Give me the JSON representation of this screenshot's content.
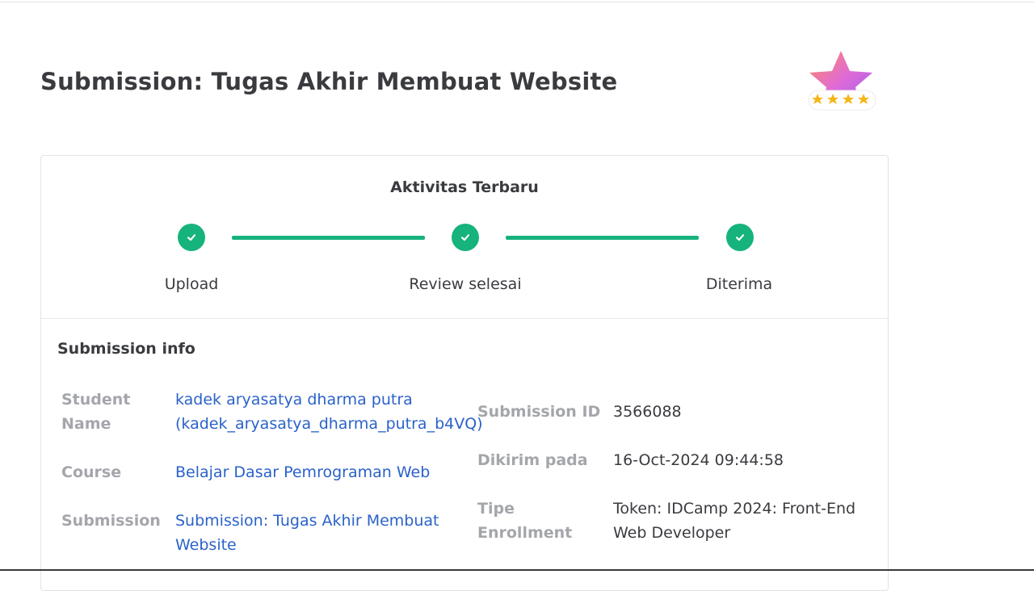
{
  "page": {
    "title": "Submission: Tugas Akhir Membuat Website",
    "badge_icon": "star-rating-badge-icon",
    "badge_stars": 4
  },
  "activity": {
    "title": "Aktivitas Terbaru",
    "steps": [
      {
        "label": "Upload",
        "icon": "check-icon"
      },
      {
        "label": "Review selesai",
        "icon": "check-icon"
      },
      {
        "label": "Diterima",
        "icon": "check-icon"
      }
    ],
    "accent_color": "#16b37c"
  },
  "submission_info": {
    "title": "Submission info",
    "student_name_label_line1": "Student",
    "student_name_label_line2": "Name",
    "student_name_line1": "kadek aryasatya dharma putra",
    "student_name_line2": "(kadek_aryasatya_dharma_putra_b4VQ)",
    "course_label": "Course",
    "course_value": "Belajar Dasar Pemrograman Web",
    "submission_label": "Submission",
    "submission_value_line1": "Submission: Tugas Akhir Membuat",
    "submission_value_line2": "Website",
    "submission_id_label": "Submission ID",
    "submission_id_value": "3566088",
    "sent_at_label": "Dikirim pada",
    "sent_at_value": "16-Oct-2024 09:44:58",
    "enrollment_label_line1": "Tipe",
    "enrollment_label_line2": "Enrollment",
    "enrollment_value_line1": "Token: IDCamp 2024: Front-End",
    "enrollment_value_line2": "Web Developer",
    "link_color": "#2a62c9"
  }
}
